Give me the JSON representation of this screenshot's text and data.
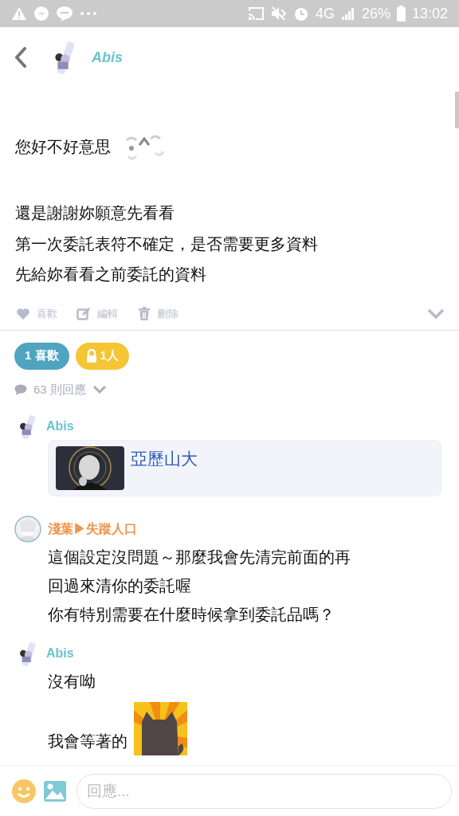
{
  "status_bar": {
    "network": "4G",
    "battery": "26%",
    "time": "13:02"
  },
  "header": {
    "author": "Abis"
  },
  "post": {
    "paragraphs": [
      {
        "text": "您好不好意思",
        "sticker": true
      },
      {
        "text": "還是謝謝妳願意先看看",
        "sticker": false
      },
      {
        "text": "第一次委託表符不確定，是否需要更多資料",
        "sticker": false
      },
      {
        "text": "先給妳看看之前委託的資料",
        "sticker": false
      }
    ],
    "actions": [
      {
        "kind": "like",
        "label": "喜歡"
      },
      {
        "kind": "edit",
        "label": "編輯"
      },
      {
        "kind": "delete",
        "label": "刪除"
      }
    ]
  },
  "badges": [
    {
      "kind": "likes",
      "label": "1 喜歡"
    },
    {
      "kind": "private",
      "label": "1人"
    }
  ],
  "reply_count": "63 則回應",
  "comments": [
    {
      "author": "Abis",
      "color": "#6ac4d2",
      "blocks": [
        {
          "kind": "card",
          "title": "亞歷山大"
        }
      ]
    },
    {
      "author": "淺葉▶失蹤人口",
      "color": "#f0954b",
      "blocks": [
        {
          "kind": "text",
          "text": "這個設定沒問題～那麼我會先清完前面的再",
          "sticker": false
        },
        {
          "kind": "text",
          "text": "回過來清你的委託喔",
          "sticker": false
        },
        {
          "kind": "text",
          "text": "你有特別需要在什麼時候拿到委託品嗎？",
          "sticker": false
        }
      ]
    },
    {
      "author": "Abis",
      "color": "#6ac4d2",
      "blocks": [
        {
          "kind": "text",
          "text": "沒有呦",
          "sticker": false
        },
        {
          "kind": "text",
          "text": "我會等著的",
          "sticker": true
        }
      ]
    }
  ],
  "composer": {
    "placeholder": "回應..."
  }
}
